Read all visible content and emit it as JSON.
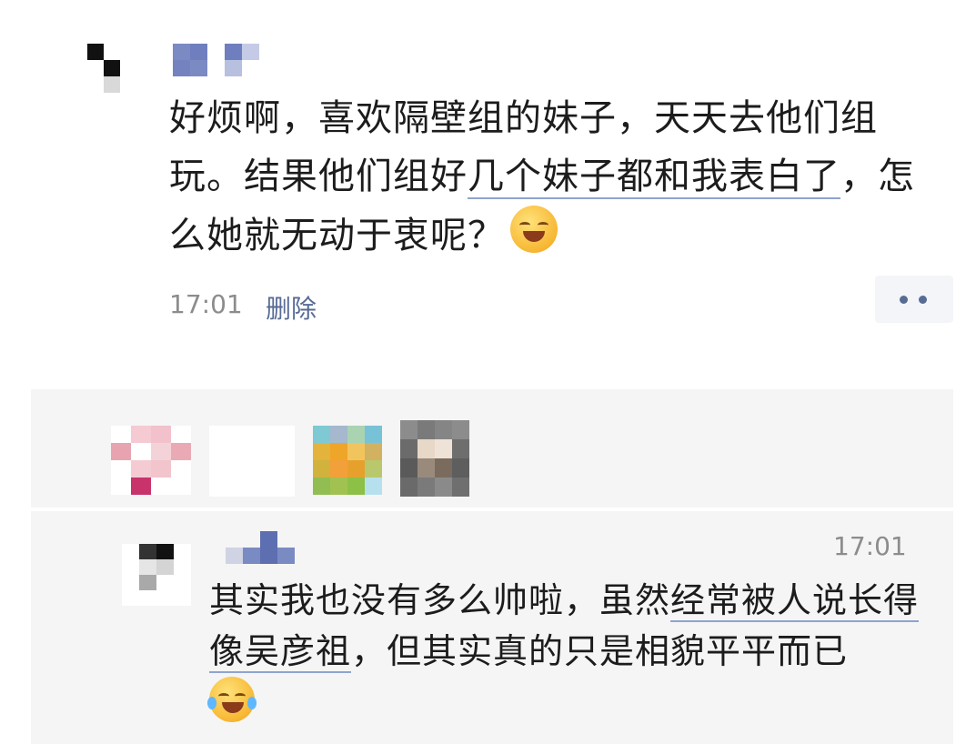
{
  "post": {
    "text_a": "好烦啊，喜欢隔壁组的妹子，天天去他们组玩。结果他们组好",
    "text_link": "几个妹子都和我表白了",
    "text_b": "，怎么她就无动于衷呢？",
    "emoji": "facepalm-emoji",
    "time": "17:01",
    "delete_label": "删除"
  },
  "comment": {
    "time": "17:01",
    "text_a": "其实我也没有多么帅啦，虽然",
    "text_link": "经常被人说长得像吴彦祖",
    "text_b": "，但其实真的只是相貌平平而已",
    "emoji": "laughing-tears-emoji"
  },
  "colors": {
    "link": "#576b95",
    "panel_bg": "#f5f5f5",
    "meta_text": "#8c8c8c"
  }
}
